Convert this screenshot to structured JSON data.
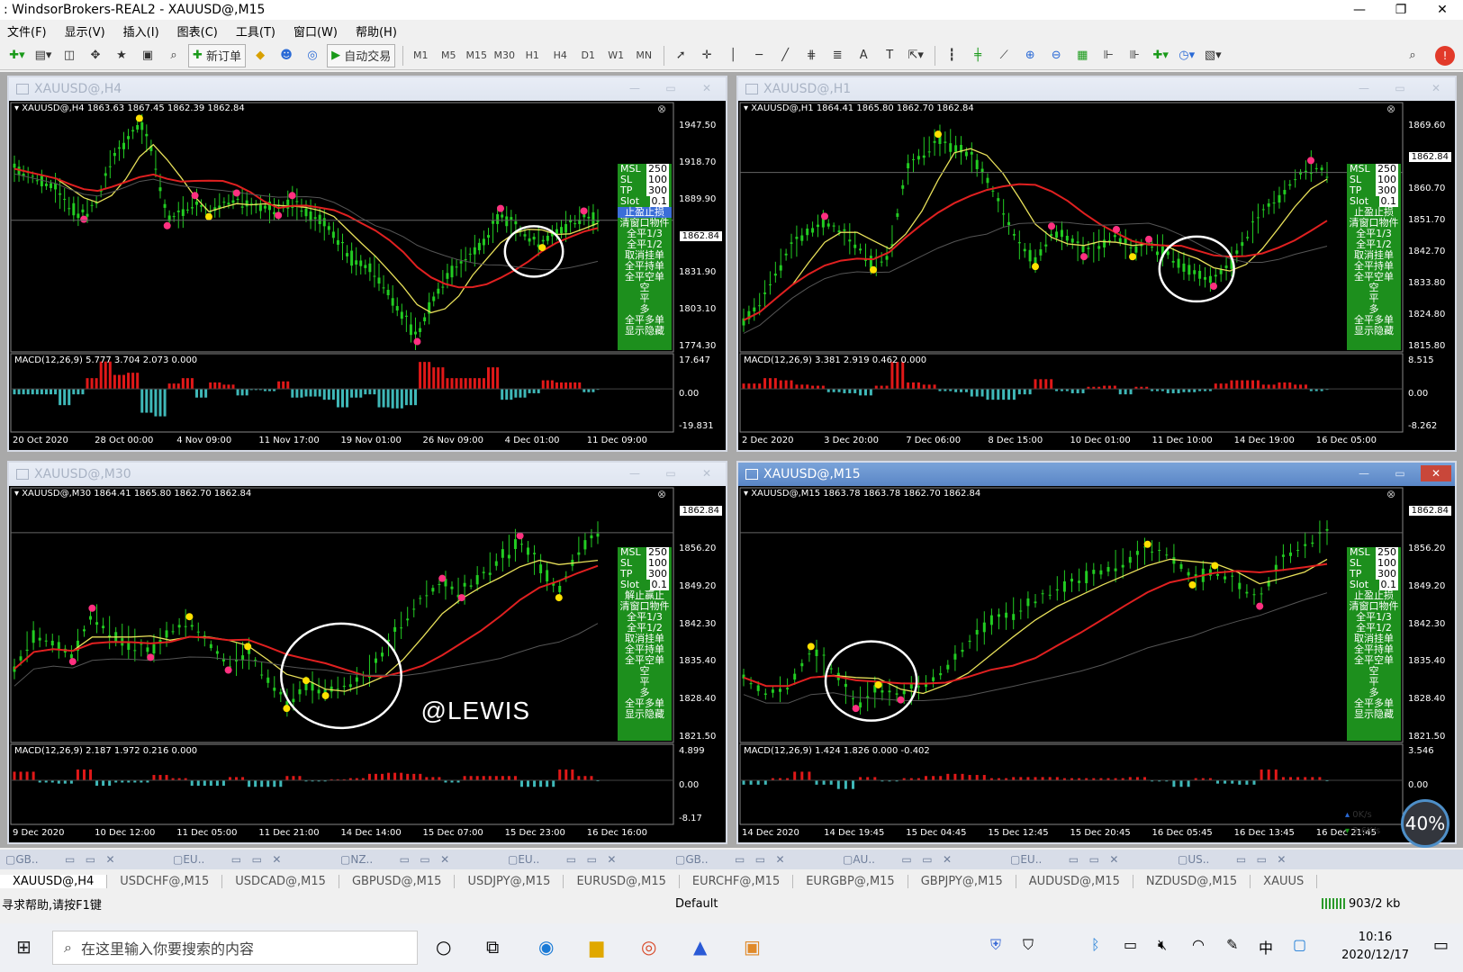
{
  "window": {
    "title": ": WindsorBrokers-REAL2 - XAUUSD@,M15"
  },
  "menu": [
    "文件(F)",
    "显示(V)",
    "插入(I)",
    "图表(C)",
    "工具(T)",
    "窗口(W)",
    "帮助(H)"
  ],
  "toolbar": {
    "new_order": "新订单",
    "auto_trading": "自动交易",
    "timeframes": [
      "M1",
      "M5",
      "M15",
      "M30",
      "H1",
      "H4",
      "D1",
      "W1",
      "MN"
    ]
  },
  "watermark": "@LEWIS",
  "charts": [
    {
      "id": "h4",
      "title": "XAUUSD@,H4",
      "info": "XAUUSD@,H4  1863.63 1867.45 1862.39 1862.84",
      "prices": [
        "1947.50",
        "1918.70",
        "1889.90",
        "1862.84",
        "1831.90",
        "1803.10",
        "1774.30"
      ],
      "macd": "MACD(12,26,9) 5.777 3.704 2.073 0.000",
      "macd_scale": [
        "17.647",
        "0.00",
        "-19.831"
      ],
      "xaxis": [
        "20 Oct 2020",
        "28 Oct 00:00",
        "4 Nov 09:00",
        "11 Nov 17:00",
        "19 Nov 01:00",
        "26 Nov 09:00",
        "4 Dec 01:00",
        "11 Dec 09:00"
      ],
      "series": [
        1905,
        1900,
        1895,
        1890,
        1875,
        1870,
        1880,
        1912,
        1925,
        1940,
        1918,
        1865,
        1870,
        1880,
        1872,
        1878,
        1882,
        1876,
        1875,
        1873,
        1880,
        1872,
        1865,
        1855,
        1838,
        1830,
        1825,
        1808,
        1790,
        1775,
        1800,
        1820,
        1830,
        1840,
        1850,
        1870,
        1860,
        1852,
        1848,
        1856,
        1862,
        1868,
        1865
      ],
      "circle": [
        0.79,
        0.6
      ],
      "circle_r": 28
    },
    {
      "id": "h1",
      "title": "XAUUSD@,H1",
      "info": "XAUUSD@,H1  1864.41 1865.80 1862.70 1862.84",
      "prices": [
        "1869.60",
        "1862.84",
        "1860.70",
        "1851.70",
        "1842.70",
        "1833.80",
        "1824.80",
        "1815.80"
      ],
      "macd": "MACD(12,26,9) 3.381 2.919 0.462 0.000",
      "macd_scale": [
        "8.515",
        "0.00",
        "-8.262"
      ],
      "xaxis": [
        "2 Dec 2020",
        "3 Dec 20:00",
        "7 Dec 06:00",
        "8 Dec 15:00",
        "10 Dec 01:00",
        "11 Dec 10:00",
        "14 Dec 19:00",
        "16 Dec 05:00"
      ],
      "series": [
        1815,
        1820,
        1830,
        1838,
        1842,
        1845,
        1842,
        1838,
        1832,
        1835,
        1860,
        1866,
        1870,
        1868,
        1865,
        1858,
        1848,
        1838,
        1833,
        1842,
        1840,
        1836,
        1838,
        1841,
        1836,
        1838,
        1836,
        1832,
        1829,
        1827,
        1832,
        1840,
        1848,
        1852,
        1858,
        1862,
        1860
      ],
      "circle": [
        0.69,
        0.67
      ],
      "circle_r": 36
    },
    {
      "id": "m30",
      "title": "XAUUSD@,M30",
      "info": "XAUUSD@,M30  1864.41 1865.80 1862.70 1862.84",
      "prices": [
        "1862.84",
        "1856.20",
        "1849.20",
        "1842.30",
        "1835.40",
        "1828.40",
        "1821.50"
      ],
      "macd": "MACD(12,26,9) 2.187 1.972 0.216 0.000",
      "macd_scale": [
        "4.899",
        "0.00",
        "-8.17"
      ],
      "xaxis": [
        "9 Dec 2020",
        "10 Dec 12:00",
        "11 Dec 05:00",
        "11 Dec 21:00",
        "14 Dec 14:00",
        "15 Dec 07:00",
        "15 Dec 23:00",
        "16 Dec 16:00"
      ],
      "series": [
        1832,
        1840,
        1838,
        1835,
        1845,
        1840,
        1838,
        1836,
        1841,
        1843,
        1838,
        1833,
        1836,
        1830,
        1824,
        1828,
        1827,
        1828,
        1830,
        1836,
        1843,
        1849,
        1852,
        1850,
        1854,
        1858,
        1862,
        1856,
        1850,
        1860,
        1864
      ],
      "circle": [
        0.5,
        0.74
      ],
      "circle_r": 58
    },
    {
      "id": "m15",
      "title": "XAUUSD@,M15",
      "info": "XAUUSD@,M15  1863.78 1863.78 1862.70 1862.84",
      "prices": [
        "1862.84",
        "1856.20",
        "1849.20",
        "1842.30",
        "1835.40",
        "1828.40",
        "1821.50"
      ],
      "macd": "MACD(12,26,9) 1.424 1.826 0.000 -0.402",
      "macd_scale": [
        "3.546",
        "0.00",
        ""
      ],
      "xaxis": [
        "14 Dec 2020",
        "14 Dec 19:45",
        "15 Dec 04:45",
        "15 Dec 12:45",
        "15 Dec 20:45",
        "16 Dec 05:45",
        "16 Dec 13:45",
        "16 Dec 21:45"
      ],
      "series": [
        1830,
        1826,
        1828,
        1836,
        1832,
        1824,
        1827,
        1826,
        1828,
        1832,
        1838,
        1843,
        1845,
        1848,
        1851,
        1853,
        1855,
        1857,
        1860,
        1859,
        1853,
        1855,
        1852,
        1848,
        1858,
        1861,
        1864
      ],
      "circle": [
        0.2,
        0.76
      ],
      "circle_r": 44
    }
  ],
  "panel": {
    "rows": [
      [
        "MSL",
        "250"
      ],
      [
        "SL",
        "100"
      ],
      [
        "TP",
        "300"
      ],
      [
        "Slot",
        "0.1"
      ]
    ],
    "items": [
      "止盈止损",
      "清窗口物件",
      "全平1/3",
      "全平1/2",
      "取消挂单",
      "全平持单",
      "全平空单",
      "空",
      "平",
      "多",
      "全平多单",
      "显示隐藏"
    ],
    "hl_m30": "解止赢止"
  },
  "tabs1": [
    "GB..",
    "EU..",
    "NZ..",
    "EU..",
    "GB..",
    "AU..",
    "EU..",
    "US.."
  ],
  "tabs2": [
    "XAUUSD@,H4",
    "USDCHF@,M15",
    "USDCAD@,M15",
    "GBPUSD@,M15",
    "USDJPY@,M15",
    "EURUSD@,M15",
    "EURCHF@,M15",
    "EURGBP@,M15",
    "GBPJPY@,M15",
    "AUDUSD@,M15",
    "NZDUSD@,M15",
    "XAUUS"
  ],
  "status": {
    "help": "寻求帮助,请按F1键",
    "profile": "Default",
    "traffic": "903/2 kb"
  },
  "network": {
    "up": "0K/s",
    "down": "3.6K/s",
    "pct": "40%"
  },
  "taskbar": {
    "search_placeholder": "在这里输入你要搜索的内容",
    "time": "10:16",
    "date": "2020/12/17"
  },
  "colors": {
    "candle": "#22cc22",
    "ma_fast": "#e8e05a",
    "ma_slow": "#e02020",
    "signal_up": "#ffe000",
    "signal_dn": "#ff3080",
    "macd_pos": "#e01818",
    "macd_neg": "#3fb8b8",
    "panel": "#1d8f1d"
  }
}
